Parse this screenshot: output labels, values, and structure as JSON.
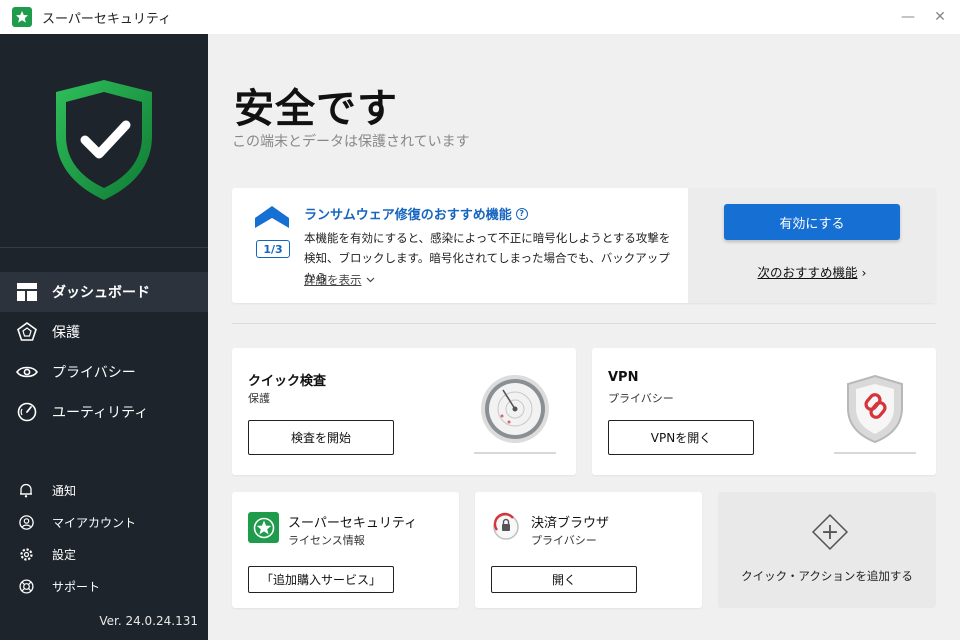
{
  "window": {
    "title": "スーパーセキュリティ",
    "minimize_symbol": "—",
    "close_symbol": "✕"
  },
  "sidebar": {
    "nav": [
      {
        "label": "ダッシュボード",
        "icon": "dashboard-icon",
        "active": true
      },
      {
        "label": "保護",
        "icon": "pentagon-icon",
        "active": false
      },
      {
        "label": "プライバシー",
        "icon": "eye-icon",
        "active": false
      },
      {
        "label": "ユーティリティ",
        "icon": "gauge-icon",
        "active": false
      }
    ],
    "secondary": [
      {
        "label": "通知",
        "icon": "bell-icon"
      },
      {
        "label": "マイアカウント",
        "icon": "user-icon"
      },
      {
        "label": "設定",
        "icon": "gear-icon"
      },
      {
        "label": "サポート",
        "icon": "lifebuoy-icon"
      }
    ],
    "version": "Ver. 24.0.24.131"
  },
  "status": {
    "title": "安全です",
    "subtitle": "この端末とデータは保護されています"
  },
  "recommendation": {
    "counter": "1/3",
    "title": "ランサムウェア修復のおすすめ機能",
    "help_symbol": "?",
    "description": "本機能を有効にすると、感染によって不正に暗号化しようとする攻撃を検知、ブロックします。暗号化されてしまった場合でも、バックアップから",
    "more_link": "詳細を表示",
    "enable_button": "有効にする",
    "next_link": "次のおすすめ機能",
    "next_chevron": "›"
  },
  "cards": {
    "quick_scan": {
      "title": "クイック検査",
      "category": "保護",
      "button": "検査を開始"
    },
    "vpn": {
      "title": "VPN",
      "category": "プライバシー",
      "button": "VPNを開く"
    },
    "license": {
      "title": "スーパーセキュリティ",
      "category": "ライセンス情報",
      "button": "「追加購入サービス」"
    },
    "browser": {
      "title": "決済ブラウザ",
      "category": "プライバシー",
      "button": "開く"
    },
    "add_action": {
      "label": "クイック・アクションを追加する",
      "symbol": "+"
    }
  },
  "colors": {
    "accent": "#1670d4",
    "brand_green": "#1e9b4b",
    "sidebar_bg": "#1e242b"
  }
}
